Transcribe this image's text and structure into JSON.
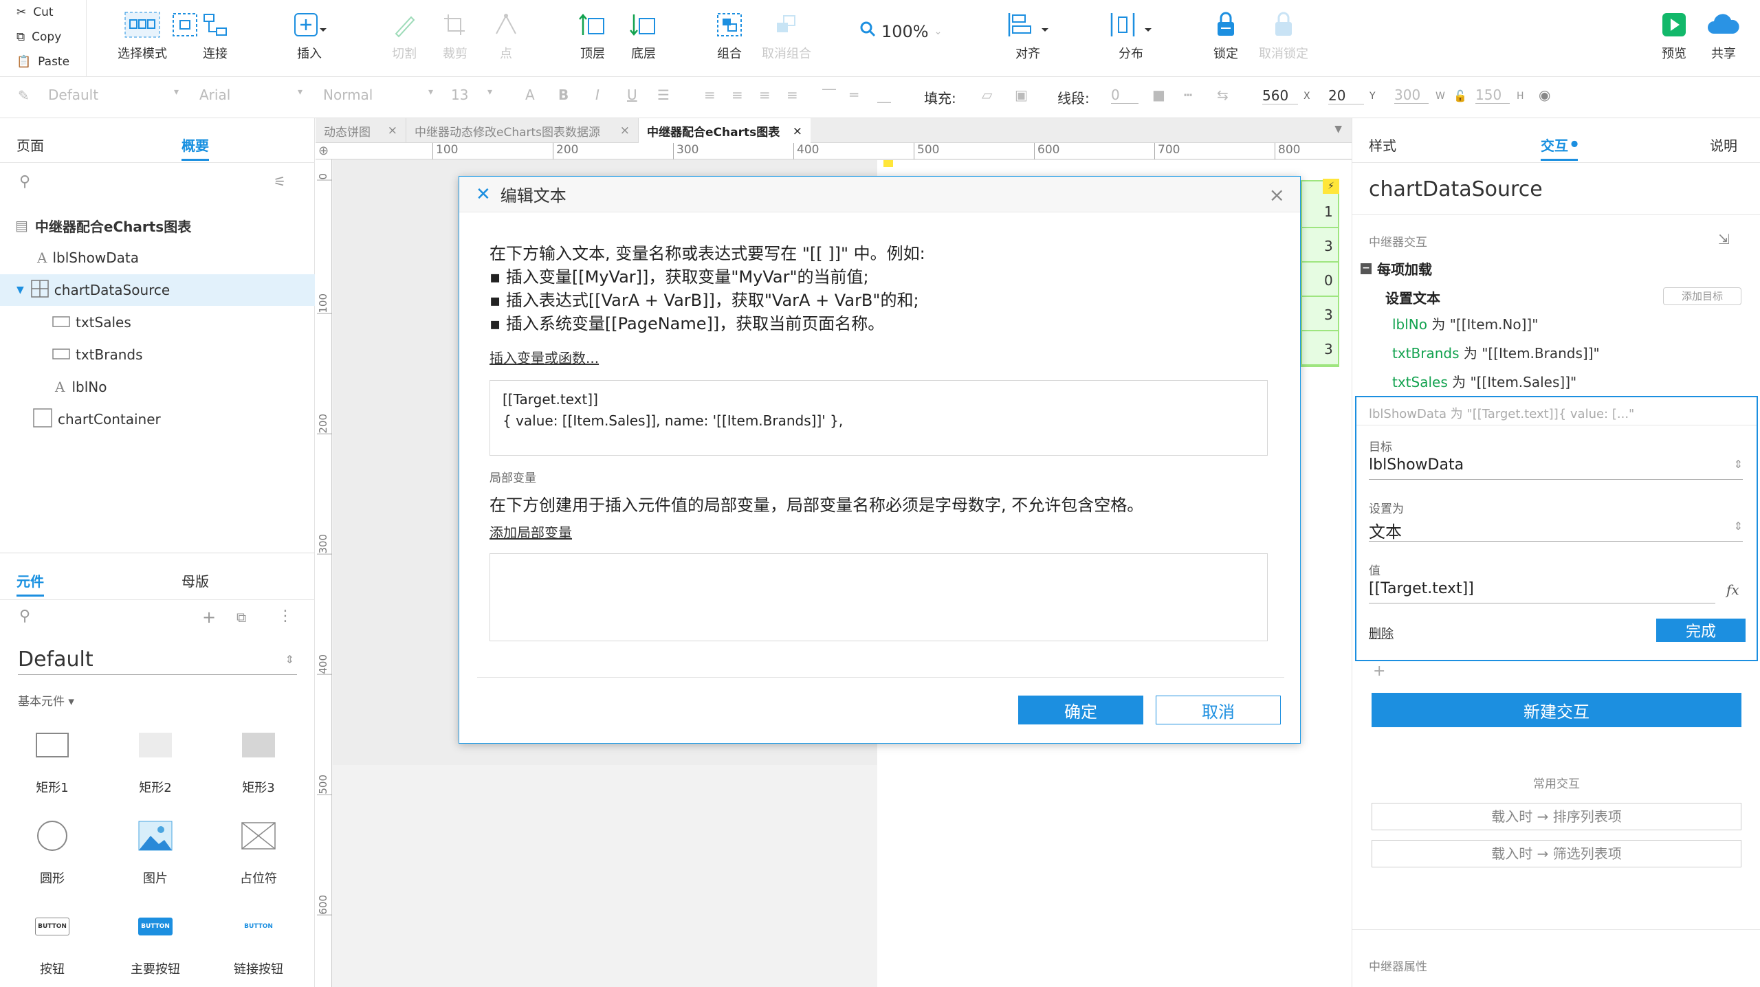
{
  "clipboard": {
    "cut": "Cut",
    "copy": "Copy",
    "paste": "Paste"
  },
  "toolbar": {
    "select_mode": "选择模式",
    "connect": "连接",
    "insert": "插入",
    "crop": "切割",
    "cut_img": "裁剪",
    "point": "点",
    "top": "顶层",
    "bottom": "底层",
    "group": "组合",
    "ungroup": "取消组合",
    "zoom": "100%",
    "align": "对齐",
    "distribute": "分布",
    "lock": "锁定",
    "unlock": "取消锁定",
    "preview": "预览",
    "share": "共享"
  },
  "format": {
    "style": "Default",
    "font": "Arial",
    "weight": "Normal",
    "size": "13",
    "fill_label": "填充:",
    "stroke_label": "线段:",
    "stroke_value": "0",
    "x": "560",
    "x_label": "X",
    "y": "20",
    "y_label": "Y",
    "w": "300",
    "w_label": "W",
    "h": "150",
    "h_label": "H"
  },
  "left": {
    "tabs": [
      "页面",
      "概要"
    ],
    "tree": {
      "root": "中继器配合eCharts图表",
      "items": [
        "lblShowData",
        "chartDataSource",
        "txtSales",
        "txtBrands",
        "lblNo",
        "chartContainer"
      ]
    },
    "lib_tabs": [
      "元件",
      "母版"
    ],
    "library": "Default",
    "category": "基本元件 ▾",
    "components": [
      "矩形1",
      "矩形2",
      "矩形3",
      "圆形",
      "图片",
      "占位符",
      "按钮",
      "主要按钮",
      "链接按钮"
    ],
    "button_caption": "BUTTON"
  },
  "doc_tabs": [
    "动态饼图",
    "中继器动态修改eCharts图表数据源",
    "中继器配合eCharts图表"
  ],
  "ruler": {
    "h": [
      "100",
      "200",
      "300",
      "400",
      "500",
      "600",
      "700",
      "800"
    ],
    "v": [
      "0",
      "100",
      "200",
      "300",
      "400",
      "500",
      "600"
    ]
  },
  "repeater_peek": [
    "1",
    "3",
    "0",
    "3",
    "3"
  ],
  "dialog": {
    "title": "编辑文本",
    "intro": "在下方输入文本, 变量名称或表达式要写在 \"[[ ]]\" 中。例如:",
    "bullet1": "▪ 插入变量[[MyVar]]，获取变量\"MyVar\"的当前值;",
    "bullet2": "▪ 插入表达式[[VarA + VarB]]，获取\"VarA + VarB\"的和;",
    "bullet3": "▪ 插入系统变量[[PageName]]，获取当前页面名称。",
    "insert_link": "插入变量或函数...",
    "text_line1": "[[Target.text]]",
    "text_line2": "{ value: [[Item.Sales]], name: '[[Item.Brands]]' },",
    "local_vars_title": "局部变量",
    "local_vars_desc": "在下方创建用于插入元件值的局部变量，局部变量名称必须是字母数字, 不允许包含空格。",
    "add_local_var": "添加局部变量",
    "ok": "确定",
    "cancel": "取消"
  },
  "right": {
    "tabs": [
      "样式",
      "交互",
      "说明"
    ],
    "widget_name": "chartDataSource",
    "section": "中继器交互",
    "event": "每项加载",
    "action": "设置文本",
    "add_target": "添加目标",
    "assignments": [
      {
        "target": "lblNo",
        "text": " 为 \"[[Item.No]]\""
      },
      {
        "target": "txtBrands",
        "text": " 为 \"[[Item.Brands]]\""
      },
      {
        "target": "txtSales",
        "text": " 为 \"[[Item.Sales]]\""
      }
    ],
    "editing_summary": "lblShowData 为 \"[[Target.text]]{ value: [...\"",
    "target_label": "目标",
    "target_value": "lblShowData",
    "set_as_label": "设置为",
    "set_as_value": "文本",
    "value_label": "值",
    "value_value": "[[Target.text]]",
    "fx": "fx",
    "delete": "删除",
    "done": "完成",
    "new_interaction": "新建交互",
    "common_title": "常用交互",
    "common": [
      "载入时 → 排序列表项",
      "载入时 → 筛选列表项"
    ],
    "repeater_props": "中继器属性"
  },
  "colors": {
    "accent": "#1c8fe0",
    "green": "#12a24f",
    "selected_bg": "#e2f1fb"
  }
}
